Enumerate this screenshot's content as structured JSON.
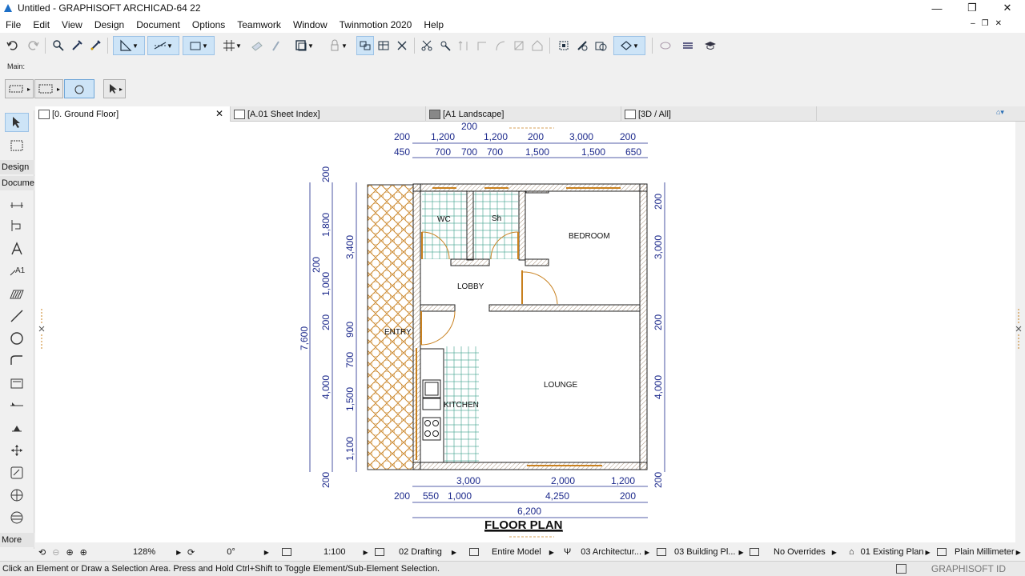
{
  "window": {
    "title": "Untitled - GRAPHISOFT ARCHICAD-64 22",
    "minimize": "—",
    "maximize": "❐",
    "close": "✕"
  },
  "menu": [
    "File",
    "Edit",
    "View",
    "Design",
    "Document",
    "Options",
    "Teamwork",
    "Window",
    "Twinmotion 2020",
    "Help"
  ],
  "toolbar": {
    "main_label": "Main:"
  },
  "toolbox": {
    "design_label": "Design",
    "document_label": "Docume",
    "more_label": "More"
  },
  "tabs": [
    {
      "label": "[0. Ground Floor]",
      "active": true
    },
    {
      "label": "[A.01 Sheet Index]",
      "active": false
    },
    {
      "label": "[A1 Landscape]",
      "active": false
    },
    {
      "label": "[3D / All]",
      "active": false
    }
  ],
  "drawing": {
    "title": "FLOOR PLAN",
    "rooms": [
      "WC",
      "Sh",
      "BEDROOM",
      "LOBBY",
      "ENTRY",
      "KITCHEN",
      "LOUNGE"
    ],
    "top_dims_row0": [
      "200"
    ],
    "top_dims_row1": [
      "200",
      "1,200",
      "1,200",
      "200",
      "3,000",
      "200"
    ],
    "top_dims_row2": [
      "450",
      "700",
      "700",
      "700",
      "1,500",
      "1,500",
      "650"
    ],
    "bottom_dims_row1": [
      "3,000",
      "2,000",
      "1,200"
    ],
    "bottom_dims_row2": [
      "200",
      "550",
      "1,000",
      "4,250",
      "200"
    ],
    "bottom_overall": "6,200",
    "left_dims_outer": [
      "200",
      "200",
      "7,600"
    ],
    "left_dims_mid": [
      "200",
      "1,800",
      "1,000",
      "200",
      "4,000",
      "200"
    ],
    "left_dims_inner": [
      "3,400",
      "900",
      "700",
      "1,500",
      "1,100"
    ],
    "right_dims": [
      "200",
      "3,000",
      "200",
      "4,000",
      "200"
    ]
  },
  "status": {
    "zoom": "128%",
    "angle": "0°",
    "scale": "1:100",
    "layer_combo": "02 Drafting",
    "model_view": "Entire Model",
    "pen_set": "03 Architectur...",
    "mvo": "03 Building Pl...",
    "overrides": "No Overrides",
    "renovation": "01 Existing Plan",
    "dimension": "Plain Millimeter"
  },
  "hint": "Click an Element or Draw a Selection Area. Press and Hold Ctrl+Shift to Toggle Element/Sub-Element Selection.",
  "graphisoft_id": "GRAPHISOFT ID",
  "colors": {
    "dimension": "#1d2a8c",
    "selected_bg": "#cde4f7",
    "window_frame": "#c8801e"
  }
}
